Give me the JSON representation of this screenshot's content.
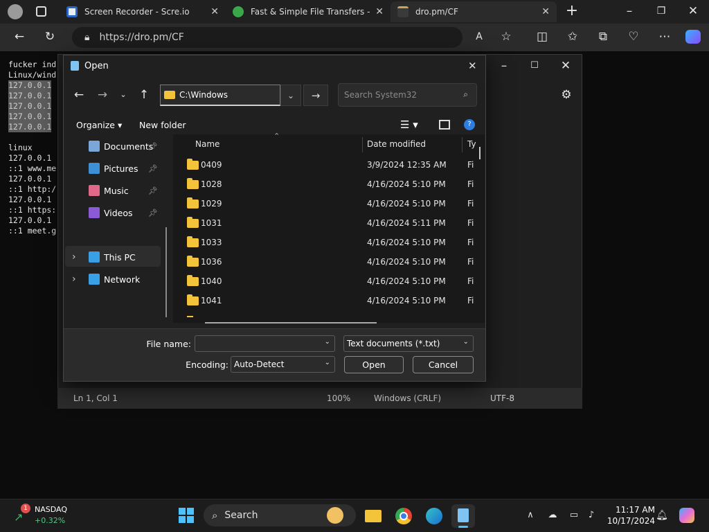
{
  "browser": {
    "tabs": [
      {
        "title": "Screen Recorder - Scre.io",
        "icon": "screen-recorder-icon"
      },
      {
        "title": "Fast & Simple File Transfers - File",
        "icon": "filemail-icon"
      },
      {
        "title": "dro.pm/CF",
        "icon": "page-icon"
      }
    ],
    "new_tab_label": "+",
    "url": "https://dro.pm/CF"
  },
  "terminal": {
    "lines": [
      {
        "text": "fucker ind",
        "selected": false
      },
      {
        "text": "Linux/wind",
        "selected": false
      },
      {
        "text": "127.0.0.1",
        "selected": true
      },
      {
        "text": "127.0.0.1",
        "selected": true
      },
      {
        "text": "127.0.0.1",
        "selected": true
      },
      {
        "text": "127.0.0.1",
        "selected": true
      },
      {
        "text": "127.0.0.1",
        "selected": true
      },
      {
        "text": "",
        "selected": false
      },
      {
        "text": "linux",
        "selected": false
      },
      {
        "text": "127.0.0.1",
        "selected": false
      },
      {
        "text": "::1 www.me",
        "selected": false
      },
      {
        "text": "127.0.0.1",
        "selected": false
      },
      {
        "text": "::1 http:/",
        "selected": false
      },
      {
        "text": "127.0.0.1",
        "selected": false
      },
      {
        "text": "::1 https:",
        "selected": false
      },
      {
        "text": "127.0.0.1",
        "selected": false
      },
      {
        "text": "::1 meet.g",
        "selected": false
      }
    ]
  },
  "notepad_status": {
    "position": "Ln 1, Col 1",
    "zoom": "100%",
    "line_ending": "Windows (CRLF)",
    "encoding": "UTF-8"
  },
  "dialog": {
    "title": "Open",
    "path": "C:\\Windows",
    "search_placeholder": "Search System32",
    "organize_label": "Organize",
    "new_folder_label": "New folder",
    "nav": [
      {
        "label": "Documents",
        "icon": "documents-icon",
        "pinned": true,
        "color": "#7aa7d8"
      },
      {
        "label": "Pictures",
        "icon": "pictures-icon",
        "pinned": true,
        "color": "#3d8fd6"
      },
      {
        "label": "Music",
        "icon": "music-icon",
        "pinned": true,
        "color": "#e0698a"
      },
      {
        "label": "Videos",
        "icon": "videos-icon",
        "pinned": true,
        "color": "#8b5bd6"
      },
      {
        "label": "This PC",
        "icon": "this-pc-icon",
        "pinned": false,
        "color": "#3aa0e6"
      },
      {
        "label": "Network",
        "icon": "network-icon",
        "pinned": false,
        "color": "#3aa0e6"
      }
    ],
    "columns": {
      "name": "Name",
      "date": "Date modified",
      "type": "Ty"
    },
    "files": [
      {
        "name": "0409",
        "date": "3/9/2024 12:35 AM",
        "type": "Fi"
      },
      {
        "name": "1028",
        "date": "4/16/2024 5:10 PM",
        "type": "Fi"
      },
      {
        "name": "1029",
        "date": "4/16/2024 5:10 PM",
        "type": "Fi"
      },
      {
        "name": "1031",
        "date": "4/16/2024 5:11 PM",
        "type": "Fi"
      },
      {
        "name": "1033",
        "date": "4/16/2024 5:10 PM",
        "type": "Fi"
      },
      {
        "name": "1036",
        "date": "4/16/2024 5:10 PM",
        "type": "Fi"
      },
      {
        "name": "1040",
        "date": "4/16/2024 5:10 PM",
        "type": "Fi"
      },
      {
        "name": "1041",
        "date": "4/16/2024 5:10 PM",
        "type": "Fi"
      }
    ],
    "file_name_label": "File name:",
    "file_name_value": "",
    "file_type": "Text documents (*.txt)",
    "encoding_label": "Encoding:",
    "encoding_value": "Auto-Detect",
    "open_label": "Open",
    "cancel_label": "Cancel"
  },
  "taskbar": {
    "widget_title": "NASDAQ",
    "widget_value": "+0.32%",
    "widget_badge": "1",
    "search_label": "Search",
    "time": "11:17 AM",
    "date": "10/17/2024",
    "accent": "#4cc2ff"
  }
}
